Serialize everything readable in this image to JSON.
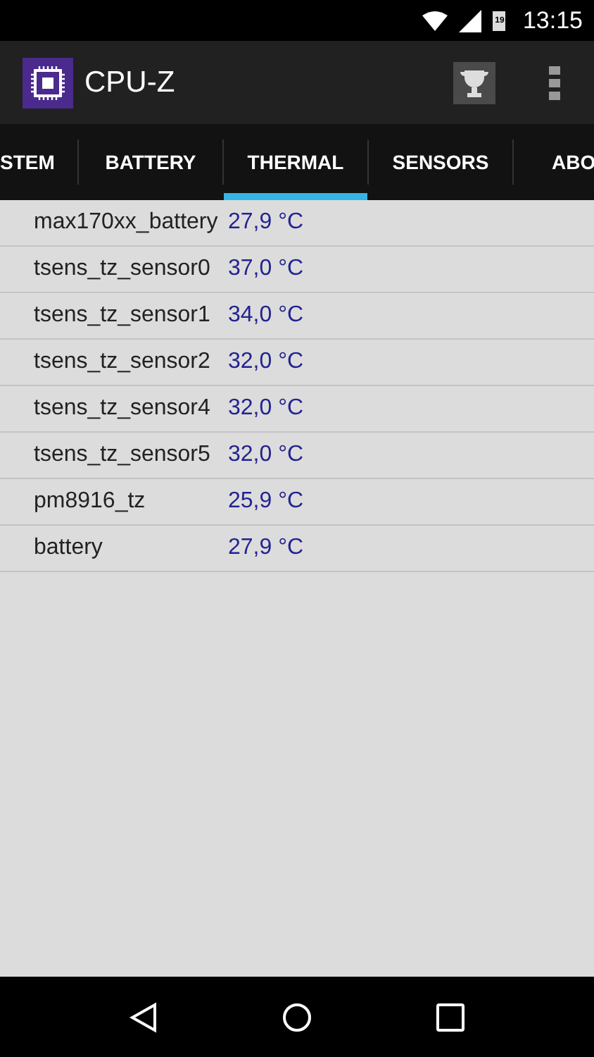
{
  "status_bar": {
    "battery_text": "19",
    "time": "13:15"
  },
  "app_bar": {
    "title": "CPU-Z"
  },
  "tabs": [
    {
      "label": "STEM",
      "selected": false
    },
    {
      "label": "BATTERY",
      "selected": false
    },
    {
      "label": "THERMAL",
      "selected": true
    },
    {
      "label": "SENSORS",
      "selected": false
    },
    {
      "label": "ABO",
      "selected": false
    }
  ],
  "rows": [
    {
      "name": "max170xx_battery",
      "value": "27,9 °C"
    },
    {
      "name": "tsens_tz_sensor0",
      "value": "37,0 °C"
    },
    {
      "name": "tsens_tz_sensor1",
      "value": "34,0 °C"
    },
    {
      "name": "tsens_tz_sensor2",
      "value": "32,0 °C"
    },
    {
      "name": "tsens_tz_sensor4",
      "value": "32,0 °C"
    },
    {
      "name": "tsens_tz_sensor5",
      "value": "32,0 °C"
    },
    {
      "name": "pm8916_tz",
      "value": "25,9 °C"
    },
    {
      "name": "battery",
      "value": "27,9 °C"
    }
  ]
}
